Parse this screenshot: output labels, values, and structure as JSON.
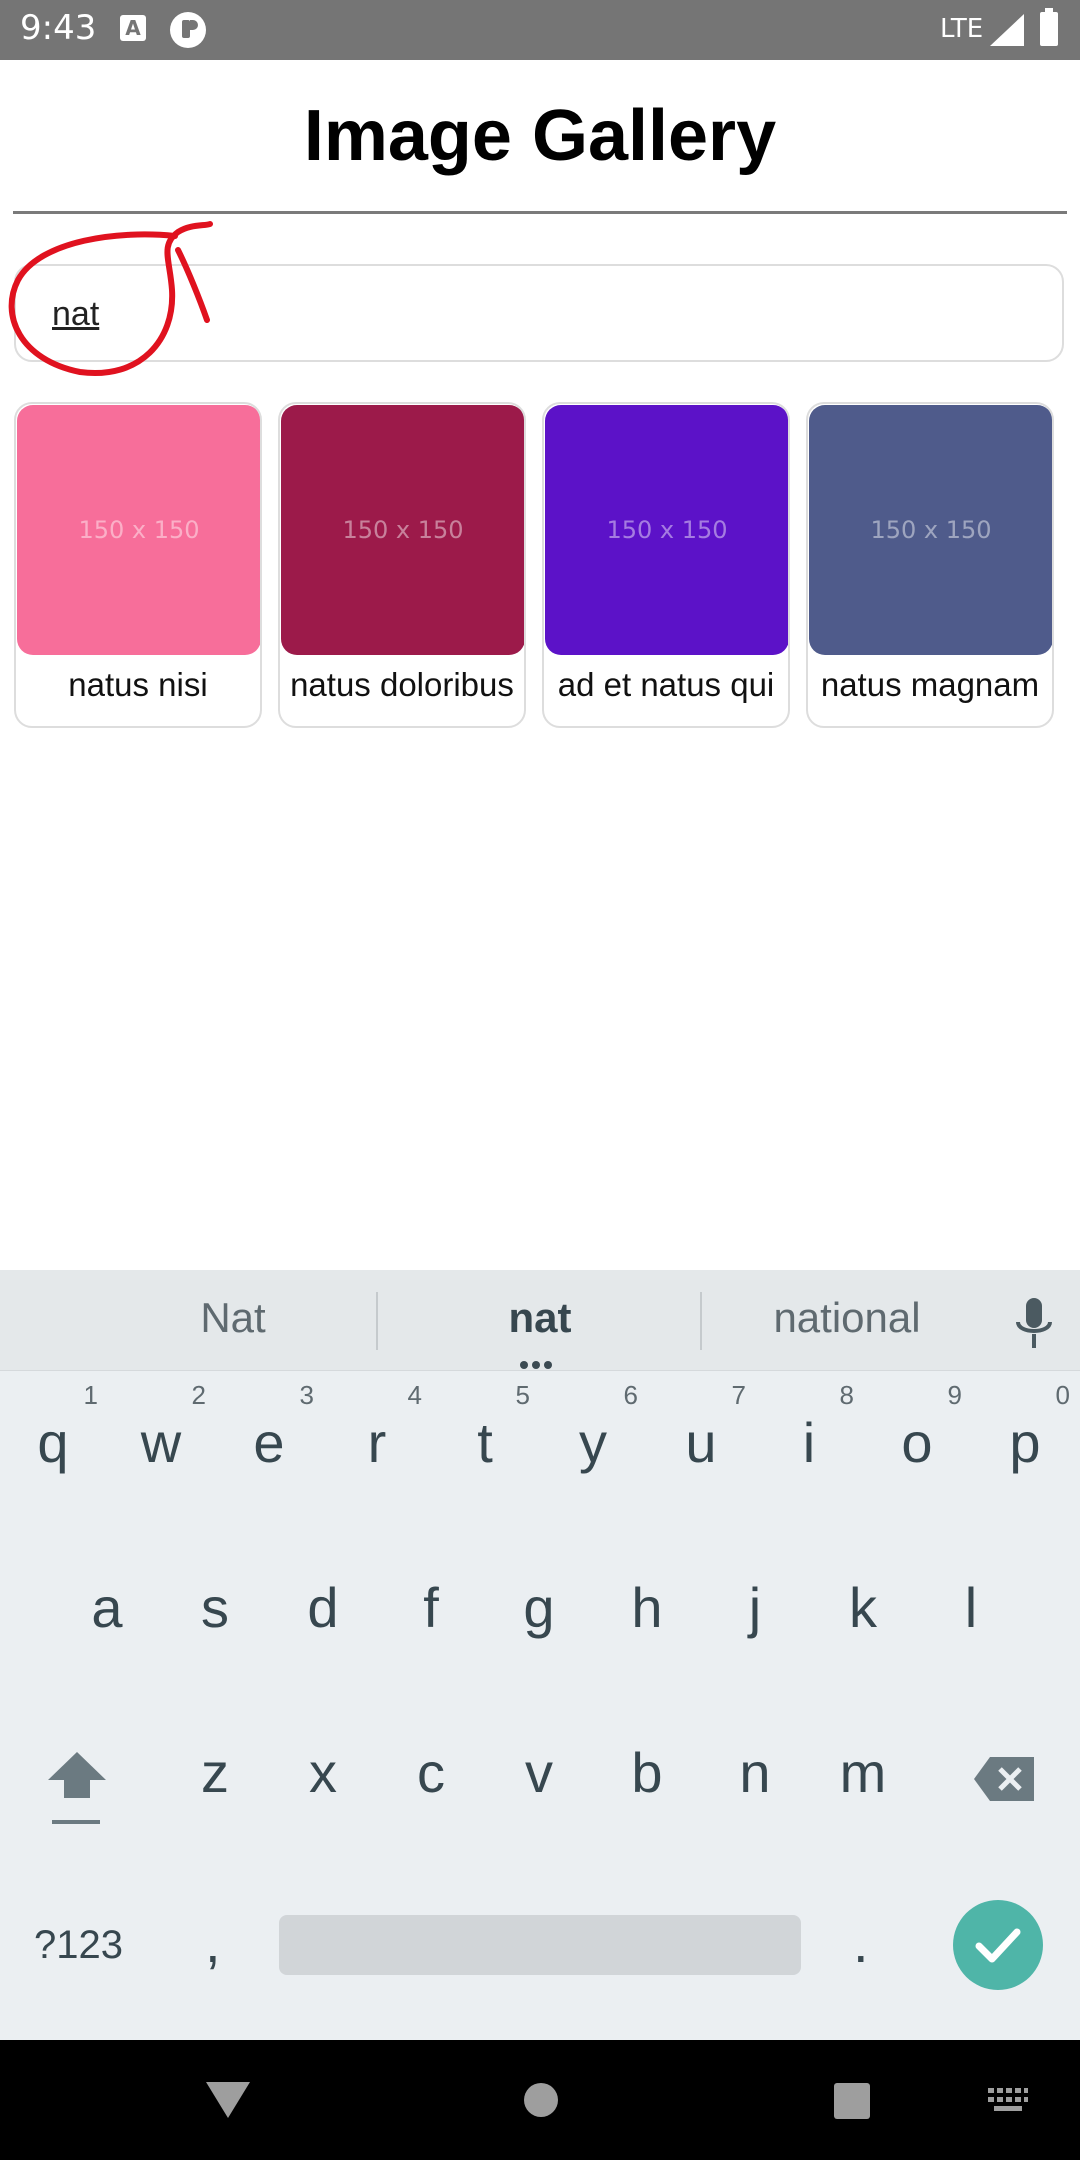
{
  "status_bar": {
    "time": "9:43",
    "network": "LTE",
    "icon_a": "A"
  },
  "header": {
    "title": "Image Gallery"
  },
  "search": {
    "value": "nat",
    "placeholder": ""
  },
  "gallery": {
    "cards": [
      {
        "placeholder_text": "150 x 150",
        "caption": "natus nisi",
        "color": "#f76e9a"
      },
      {
        "placeholder_text": "150 x 150",
        "caption": "natus doloribus",
        "color": "#9c1a4a"
      },
      {
        "placeholder_text": "150 x 150",
        "caption": "ad et natus qui",
        "color": "#5c12c8"
      },
      {
        "placeholder_text": "150 x 150",
        "caption": "natus magnam",
        "color": "#4f5b8b"
      }
    ]
  },
  "keyboard": {
    "suggestions": [
      "Nat",
      "nat",
      "national"
    ],
    "row1": [
      {
        "letter": "q",
        "num": "1"
      },
      {
        "letter": "w",
        "num": "2"
      },
      {
        "letter": "e",
        "num": "3"
      },
      {
        "letter": "r",
        "num": "4"
      },
      {
        "letter": "t",
        "num": "5"
      },
      {
        "letter": "y",
        "num": "6"
      },
      {
        "letter": "u",
        "num": "7"
      },
      {
        "letter": "i",
        "num": "8"
      },
      {
        "letter": "o",
        "num": "9"
      },
      {
        "letter": "p",
        "num": "0"
      }
    ],
    "row2": [
      "a",
      "s",
      "d",
      "f",
      "g",
      "h",
      "j",
      "k",
      "l"
    ],
    "row3": [
      "z",
      "x",
      "c",
      "v",
      "b",
      "n",
      "m"
    ],
    "symbols_label": "?123",
    "comma": ",",
    "period": ".",
    "accent_color": "#4fb5a8"
  },
  "annotation": {
    "color": "#e0121f"
  }
}
